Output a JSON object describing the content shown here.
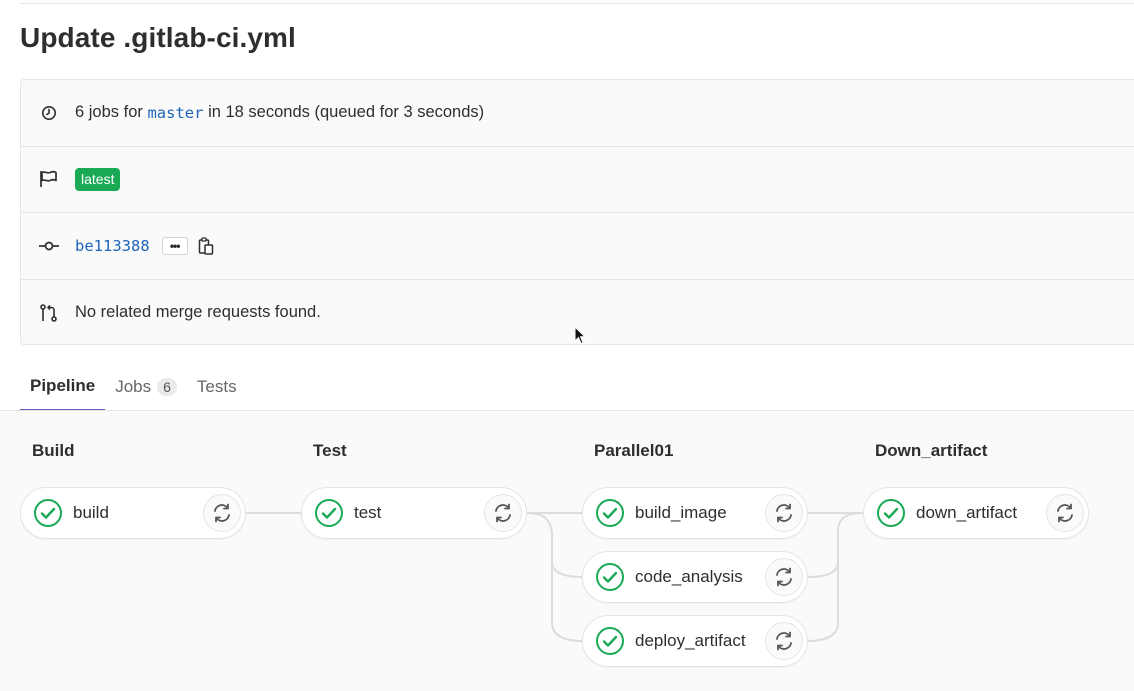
{
  "title": "Update .gitlab-ci.yml",
  "info": {
    "jobs_prefix": "6 jobs for",
    "branch": "master",
    "jobs_suffix": "in 18 seconds (queued for 3 seconds)",
    "badge": "latest",
    "commit": "be113388",
    "ellipsis": "•••",
    "merge_requests": "No related merge requests found."
  },
  "tabs": [
    {
      "label": "Pipeline",
      "active": true
    },
    {
      "label": "Jobs",
      "count": "6"
    },
    {
      "label": "Tests"
    }
  ],
  "stages": [
    {
      "name": "Build",
      "jobs": [
        "build"
      ]
    },
    {
      "name": "Test",
      "jobs": [
        "test"
      ]
    },
    {
      "name": "Parallel01",
      "jobs": [
        "build_image",
        "code_analysis",
        "deploy_artifact"
      ]
    },
    {
      "name": "Down_artifact",
      "jobs": [
        "down_artifact"
      ]
    }
  ],
  "colors": {
    "success": "#1aaa55",
    "link": "#1f64b8",
    "active_tab": "#6b4fbb"
  },
  "icons": {
    "duration": "clock-icon",
    "flag": "flag-icon",
    "commit": "commit-icon",
    "merge_request": "merge-request-icon",
    "copy": "clipboard-icon",
    "status": "status-success-icon",
    "retry": "retry-icon"
  }
}
